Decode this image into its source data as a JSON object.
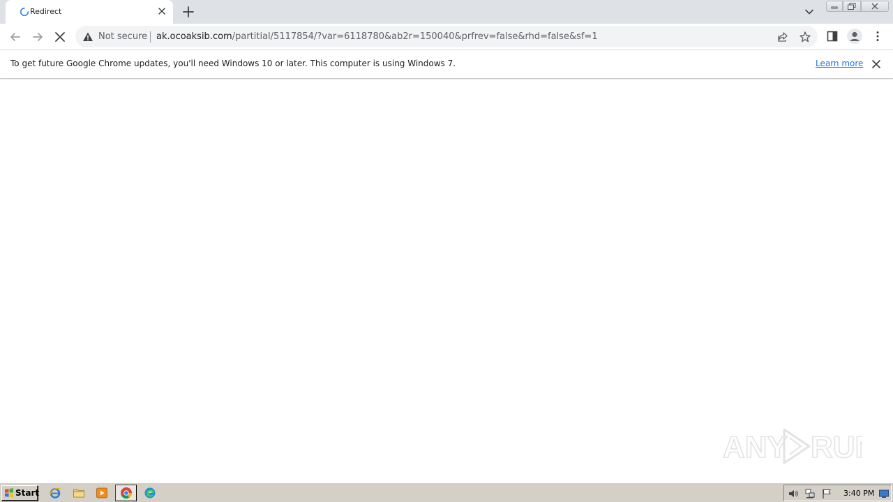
{
  "tab": {
    "title": "Redirect"
  },
  "address_bar": {
    "security_label": "Not secure",
    "url_host": "ak.ocoaksib.com",
    "url_path": "/partitial/5117854/?var=6118780&ab2r=150040&prfrev=false&rhd=false&sf=1"
  },
  "infobar": {
    "message": "To get future Google Chrome updates, you'll need Windows 10 or later. This computer is using Windows 7.",
    "link_label": "Learn more"
  },
  "watermark": {
    "left": "ANY",
    "right": "RUN"
  },
  "taskbar": {
    "start_label": "Start",
    "apps": [
      "internet-explorer-icon",
      "folder-icon",
      "media-player-icon",
      "chrome-icon",
      "edge-icon"
    ],
    "clock": "3:40 PM"
  },
  "colors": {
    "tabstrip_bg": "#dee1e6",
    "omnibox_bg": "#f1f3f4",
    "link": "#1a73e8",
    "taskbar_bg": "#d4d0c8"
  }
}
